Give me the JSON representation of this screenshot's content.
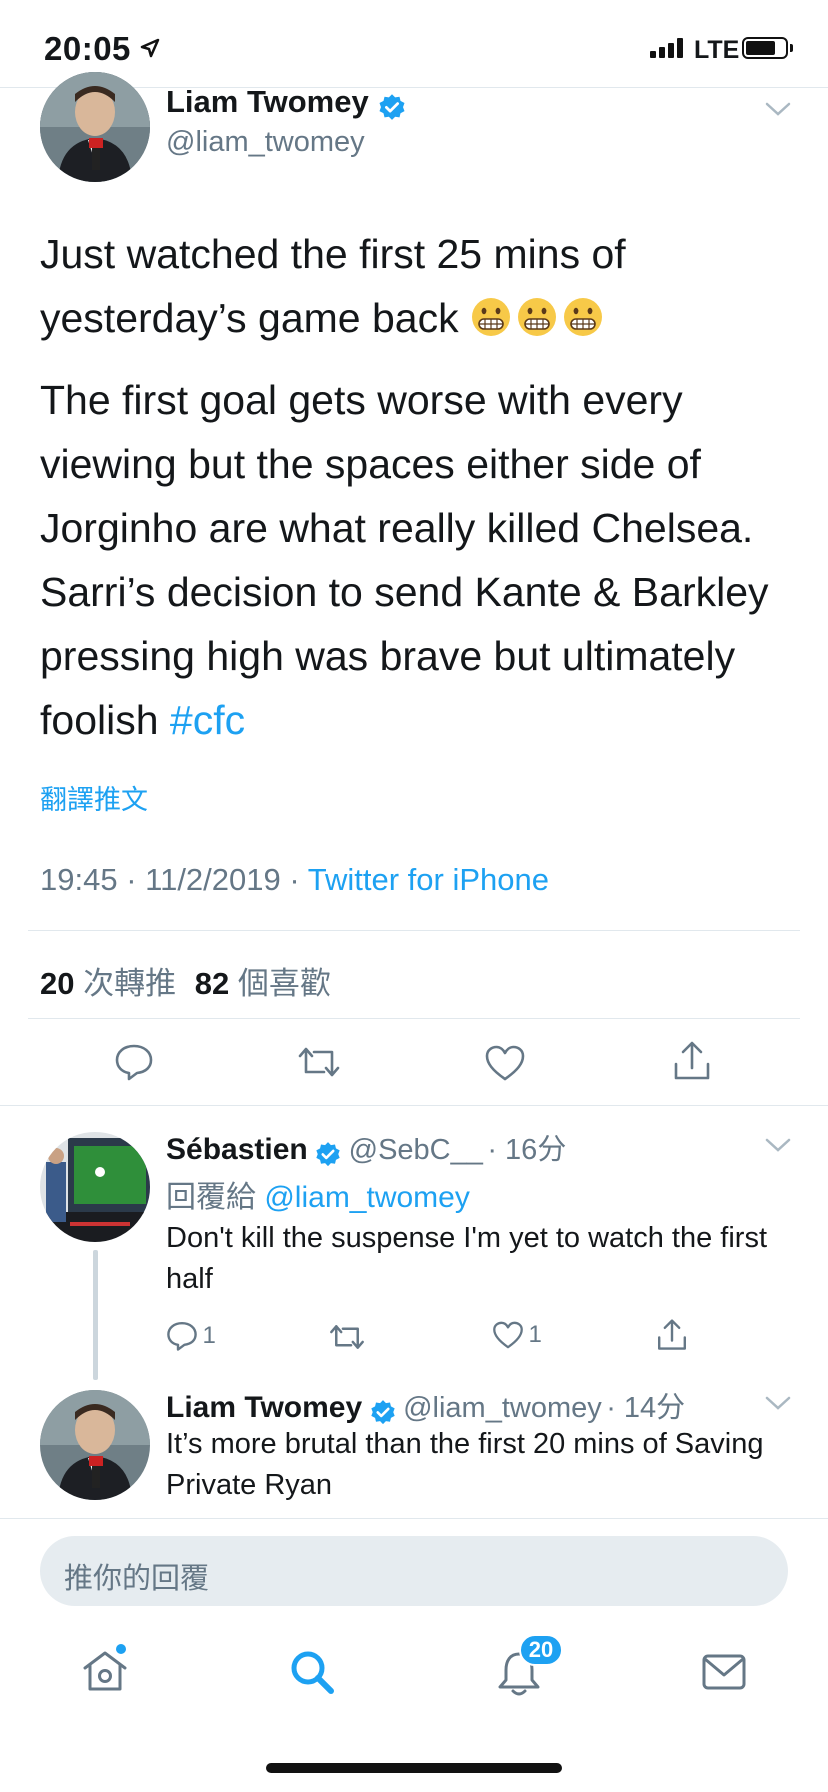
{
  "status_bar": {
    "time": "20:05",
    "carrier": "LTE"
  },
  "main_tweet": {
    "author_name": "Liam Twomey",
    "author_handle": "@liam_twomey",
    "text_line1": "Just watched the first 25 mins of",
    "text_line2": "yesterday’s game back",
    "emoji": "grimacing-face",
    "text_para2": "The first goal gets worse with every viewing but the spaces either side of Jorginho are what really killed Chelsea. Sarri’s decision to send Kante & Barkley pressing high was brave but ultimately foolish",
    "hashtag": "#cfc",
    "translate_label": "翻譯推文",
    "time": "19:45",
    "date": "11/2/2019",
    "source": "Twitter for iPhone",
    "retweets_count": "20",
    "retweets_label": "次轉推",
    "likes_count": "82",
    "likes_label": "個喜歡"
  },
  "replies": [
    {
      "name": "Sébastien",
      "handle": "@SebC__",
      "age": "· 16分",
      "replying_to_label": "回覆給",
      "replying_to": "@liam_twomey",
      "text": "Don't kill the suspense I'm yet to watch the first half",
      "reply_count": "1",
      "like_count": "1"
    },
    {
      "name": "Liam Twomey",
      "handle": "@liam_twomey",
      "age": "· 14分",
      "text": "It’s more brutal than the first 20 mins of Saving Private Ryan"
    }
  ],
  "compose": {
    "placeholder": "推你的回覆"
  },
  "tabbar": {
    "notifications_badge": "20"
  },
  "colors": {
    "accent": "#1da1f2",
    "muted": "#657786",
    "text": "#14171a",
    "divider": "#e1e8ed"
  }
}
